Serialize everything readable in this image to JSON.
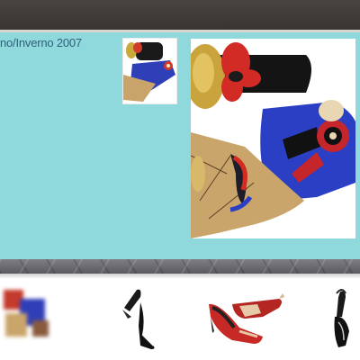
{
  "collection": {
    "title": "no/Inverno 2007"
  },
  "colors": {
    "header": "#3f3936",
    "panel": "#8fd9dc",
    "title_text": "#2f5f7a",
    "strip": "#6a6a70"
  },
  "images": {
    "thumbnail": "shoe-thumbnail",
    "main": "shoe-main-photo",
    "carousel": [
      "blurred-shoe",
      "black-heel-shoe",
      "red-pump-shoe",
      "black-slingback-shoe"
    ]
  }
}
